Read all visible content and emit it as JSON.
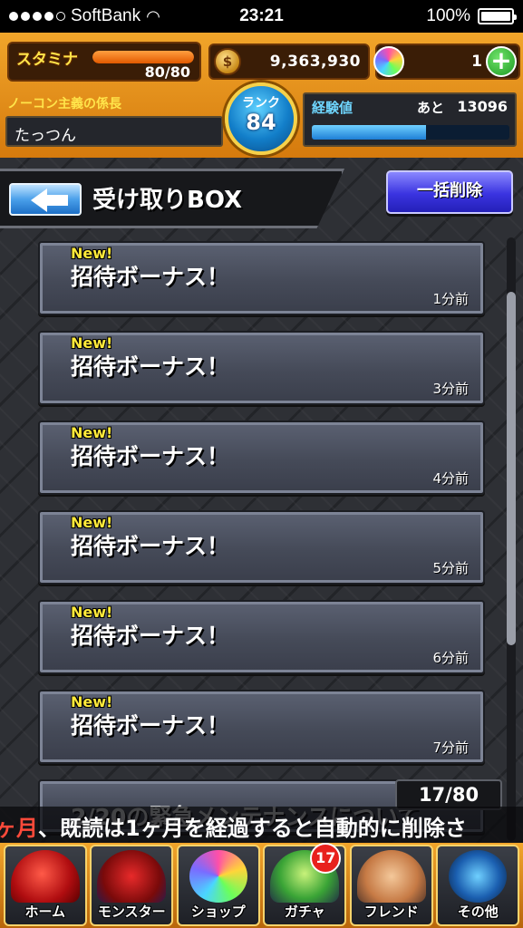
{
  "statusbar": {
    "carrier": "SoftBank",
    "time": "23:21",
    "battery": "100%",
    "signal_bars": 4,
    "battery_level": 1.0
  },
  "header": {
    "stamina_label": "スタミナ",
    "stamina_value": "80/80",
    "stamina_fraction": 1.0,
    "gold_value": "9,363,930",
    "orb_value": "1",
    "plus_label": "+",
    "player_title": "ノーコン主義の係長",
    "player_name": "たっつん",
    "rank_label": "ランク",
    "rank_value": "84",
    "exp_label": "経験値",
    "exp_next_label": "あと",
    "exp_next_value": "13096",
    "exp_fraction": 0.58
  },
  "page": {
    "title": "受け取りBOX",
    "delete_all_label": "一括削除"
  },
  "messages": [
    {
      "new": "New!",
      "title": "招待ボーナス！",
      "time": "1分前"
    },
    {
      "new": "New!",
      "title": "招待ボーナス！",
      "time": "3分前"
    },
    {
      "new": "New!",
      "title": "招待ボーナス！",
      "time": "4分前"
    },
    {
      "new": "New!",
      "title": "招待ボーナス！",
      "time": "5分前"
    },
    {
      "new": "New!",
      "title": "招待ボーナス！",
      "time": "6分前"
    },
    {
      "new": "New!",
      "title": "招待ボーナス！",
      "time": "7分前"
    }
  ],
  "partial_message": {
    "title": "2/20の緊急メンテナンスについて"
  },
  "count": "17/80",
  "ticker": {
    "lead": "ヶ月",
    "text": "、既読は1ヶ月を経過すると自動的に削除さ"
  },
  "nav": {
    "items": [
      {
        "label": "ホーム",
        "icon": "home-dragon-icon"
      },
      {
        "label": "モンスター",
        "icon": "monster-icon"
      },
      {
        "label": "ショップ",
        "icon": "orb-shop-icon"
      },
      {
        "label": "ガチャ",
        "icon": "egg-gacha-icon",
        "badge": "17"
      },
      {
        "label": "フレンド",
        "icon": "handshake-icon"
      },
      {
        "label": "その他",
        "icon": "radar-other-icon"
      }
    ]
  },
  "colors": {
    "header_orange": "#e8901c",
    "new_yellow": "#ffea3a",
    "delete_blue": "#3a33e0",
    "exp_blue": "#1e7fd6",
    "badge_red": "#e8211d"
  }
}
